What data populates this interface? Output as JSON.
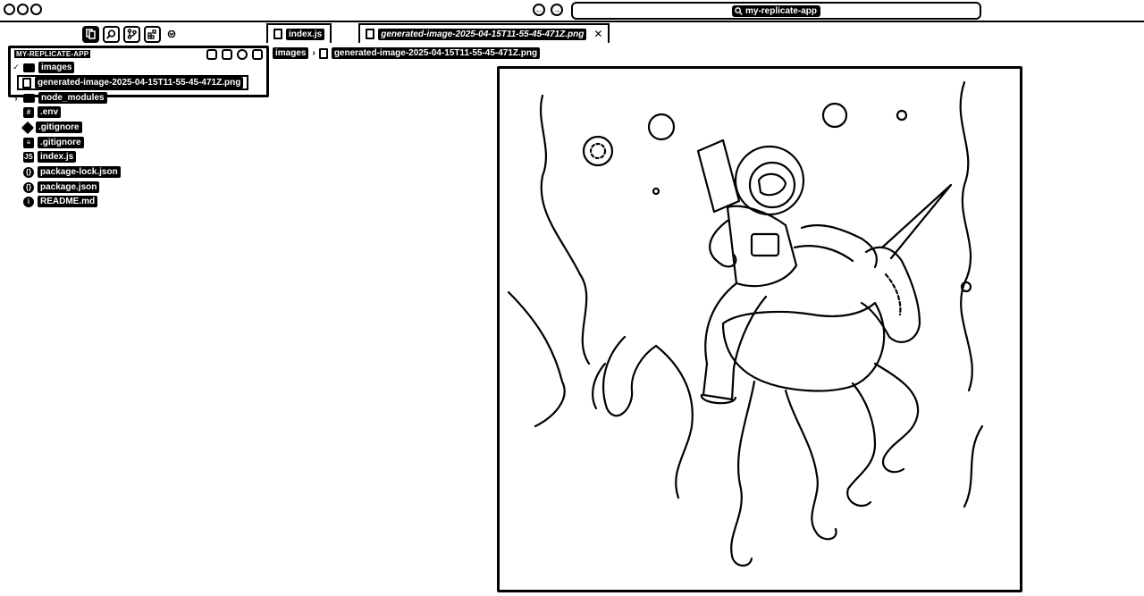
{
  "window": {
    "search_label": "my-replicate-app"
  },
  "activity_bar": {
    "items": [
      "explorer-icon",
      "search-icon",
      "source-control-icon",
      "extensions-icon",
      "chevron-down-icon"
    ]
  },
  "tabs": [
    {
      "label": "index.js",
      "active": false
    },
    {
      "label": "generated-image-2025-04-15T11-55-45-471Z.png",
      "active": true
    }
  ],
  "explorer": {
    "title": "MY-REPLICATE-APP",
    "tree": [
      {
        "label": "images",
        "type": "folder",
        "expanded": true
      },
      {
        "label": "generated-image-2025-04-15T11-55-45-471Z.png",
        "type": "file",
        "selected": true
      },
      {
        "label": "node_modules",
        "type": "folder",
        "expanded": false
      },
      {
        "label": ".env",
        "type": "file",
        "icon": "env-icon"
      },
      {
        "label": ".gitignore",
        "type": "file",
        "icon": "git-icon"
      },
      {
        "label": ".gitignore",
        "type": "file",
        "icon": "file-icon"
      },
      {
        "label": "index.js",
        "type": "file",
        "icon": "js-icon"
      },
      {
        "label": "package-lock.json",
        "type": "file",
        "icon": "json-icon"
      },
      {
        "label": "package.json",
        "type": "file",
        "icon": "json-icon"
      },
      {
        "label": "README.md",
        "type": "file",
        "icon": "info-icon"
      }
    ]
  },
  "breadcrumb": {
    "items": [
      "images",
      "generated-image-2025-04-15T11-55-45-471Z.png"
    ]
  },
  "preview": {
    "subject": "astronaut-riding-unicorn-image"
  }
}
